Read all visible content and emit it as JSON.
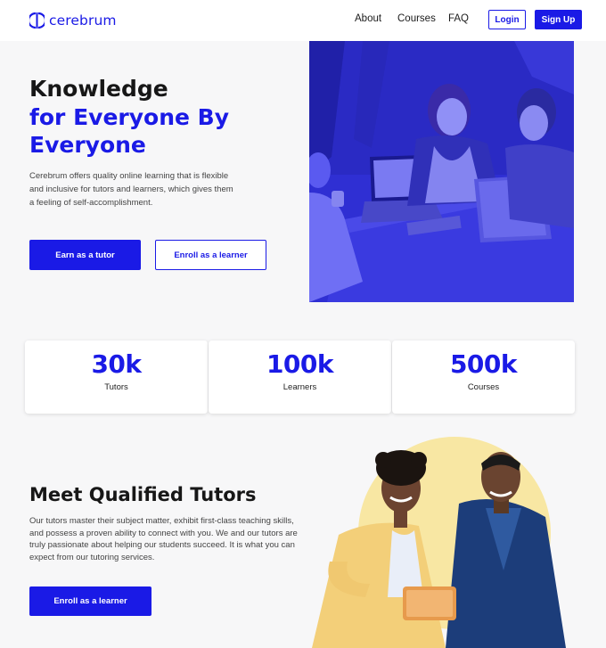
{
  "brand": {
    "name": "cerebrum",
    "accent": "#1a1ae6"
  },
  "nav": {
    "links": [
      "About",
      "Courses",
      "FAQ"
    ],
    "login": "Login",
    "signup": "Sign Up"
  },
  "hero": {
    "title_line1": "Knowledge",
    "title_line2": "for Everyone By",
    "title_line3": "Everyone",
    "description": "Cerebrum offers quality online learning that is flexible and inclusive for tutors and learners, which gives them a feeling of self-accomplishment.",
    "cta_primary": "Earn as a tutor",
    "cta_secondary": "Enroll as a learner"
  },
  "stats": [
    {
      "value": "30k",
      "label": "Tutors"
    },
    {
      "value": "100k",
      "label": "Learners"
    },
    {
      "value": "500k",
      "label": "Courses"
    }
  ],
  "tutors": {
    "title": "Meet Qualified Tutors",
    "description": "Our tutors master their subject matter, exhibit first-class teaching skills, and possess a proven ability to connect with you. We and our tutors are truly passionate about helping our students succeed. It is what you can expect from our tutoring services.",
    "cta": "Enroll as a learner"
  }
}
